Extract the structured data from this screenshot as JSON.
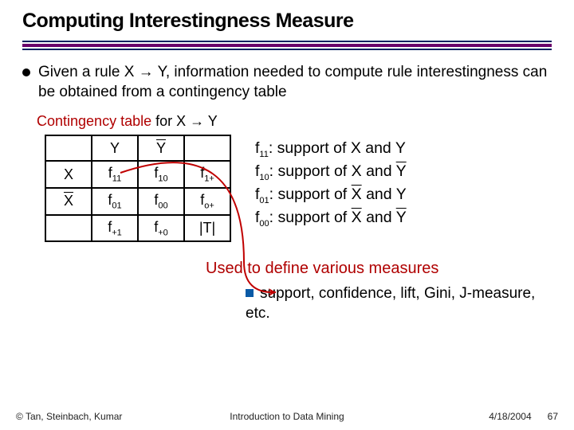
{
  "title": "Computing Interestingness Measure",
  "bullet": "Given a rule X → Y, information needed to compute rule interestingness can be obtained from a contingency table",
  "caption": {
    "prefix": "Contingency table",
    "suffix": " for X → Y"
  },
  "table": {
    "cols": [
      "",
      "Y",
      "Y̅",
      ""
    ],
    "rows": [
      [
        "X",
        "f_11",
        "f_10",
        "f_1+"
      ],
      [
        "X̅",
        "f_01",
        "f_00",
        "f_o+"
      ],
      [
        "",
        "f_+1",
        "f_+0",
        "|T|"
      ]
    ]
  },
  "legend": [
    "f_11: support of X and Y",
    "f_10: support of X and Y̅",
    "f_01: support of X̅ and Y",
    "f_00: support of X̅ and Y̅"
  ],
  "used": "Used to define various measures",
  "sublist": "support, confidence, lift, Gini, J-measure, etc.",
  "footer": {
    "left": "© Tan, Steinbach, Kumar",
    "center": "Introduction to Data Mining",
    "right_date": "4/18/2004",
    "page": "67"
  }
}
